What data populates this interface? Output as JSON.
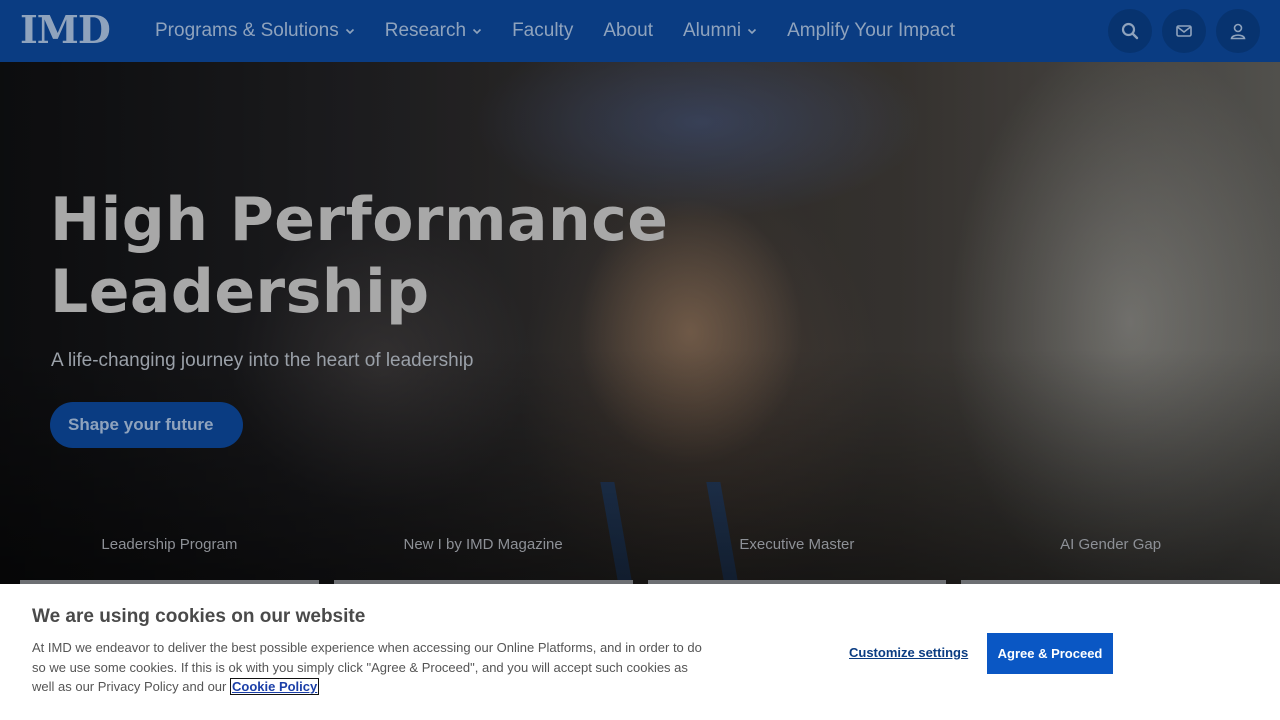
{
  "header": {
    "logo_text": "IMD",
    "nav": [
      {
        "label": "Programs & Solutions",
        "has_dropdown": true
      },
      {
        "label": "Research",
        "has_dropdown": true
      },
      {
        "label": "Faculty",
        "has_dropdown": false
      },
      {
        "label": "About",
        "has_dropdown": false
      },
      {
        "label": "Alumni",
        "has_dropdown": true
      },
      {
        "label": "Amplify Your Impact",
        "has_dropdown": false
      }
    ],
    "icons": [
      "search-icon",
      "mail-icon",
      "user-icon"
    ]
  },
  "hero": {
    "title_line1": "High Performance",
    "title_line2": "Leadership",
    "subtitle": "A life-changing journey into the heart of leadership",
    "cta_label": "Shape your future",
    "quicklinks": [
      {
        "label": "Leadership Program"
      },
      {
        "label": "New I by IMD Magazine"
      },
      {
        "label": "Executive Master"
      },
      {
        "label": "AI Gender Gap"
      }
    ]
  },
  "cookie": {
    "title": "We are using cookies on our website",
    "text": "At IMD we endeavor to deliver the best possible experience when accessing our Online Platforms, and in order to do so we use some cookies. If this is ok with you simply click \"Agree & Proceed\", and you will accept such cookies as well as our Privacy Policy and our",
    "link_label": "Cookie Policy",
    "customize_label": "Customize settings",
    "agree_label": "Agree & Proceed"
  },
  "colors": {
    "header_bg": "#0a3c82",
    "accent_button": "#0a57c4",
    "link": "#1b3fa8"
  }
}
